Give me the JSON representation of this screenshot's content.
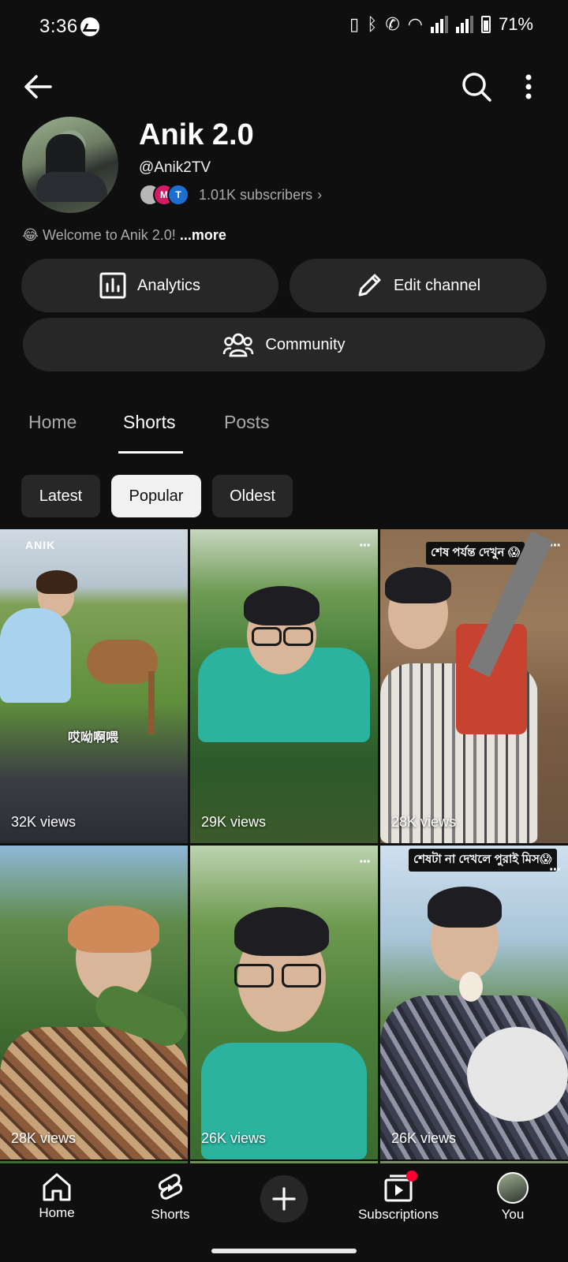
{
  "status_bar": {
    "time": "3:36",
    "battery": "71%"
  },
  "channel": {
    "name": "Anik 2.0",
    "handle": "@Anik2TV",
    "subscribers": "1.01K subscribers",
    "description": "😂 Welcome to Anik 2.0!",
    "more_label": "...more",
    "subscriber_avatar_letters": [
      "",
      "M",
      "T"
    ]
  },
  "actions": {
    "analytics": "Analytics",
    "edit_channel": "Edit channel",
    "community": "Community"
  },
  "tabs": [
    {
      "label": "Home",
      "active": false
    },
    {
      "label": "Shorts",
      "active": true
    },
    {
      "label": "Posts",
      "active": false
    }
  ],
  "chips": [
    {
      "label": "Latest",
      "active": false
    },
    {
      "label": "Popular",
      "active": true
    },
    {
      "label": "Oldest",
      "active": false
    }
  ],
  "shorts": [
    {
      "views": "32K views",
      "overlay_logo": "ANIK",
      "caption": "哎呦啊喂"
    },
    {
      "views": "29K views"
    },
    {
      "views": "28K views",
      "badge": "শেষ পর্যন্ত দেখুন 😱"
    },
    {
      "views": "28K views"
    },
    {
      "views": "26K views"
    },
    {
      "views": "26K views",
      "badge": "শেষটা না দেখলে পুরাই মিস😱"
    }
  ],
  "bottom_nav": {
    "home": "Home",
    "shorts": "Shorts",
    "subscriptions": "Subscriptions",
    "you": "You"
  },
  "colors": {
    "background": "#0f0f0f",
    "button_bg": "#272727",
    "accent_red": "#ff0033"
  }
}
